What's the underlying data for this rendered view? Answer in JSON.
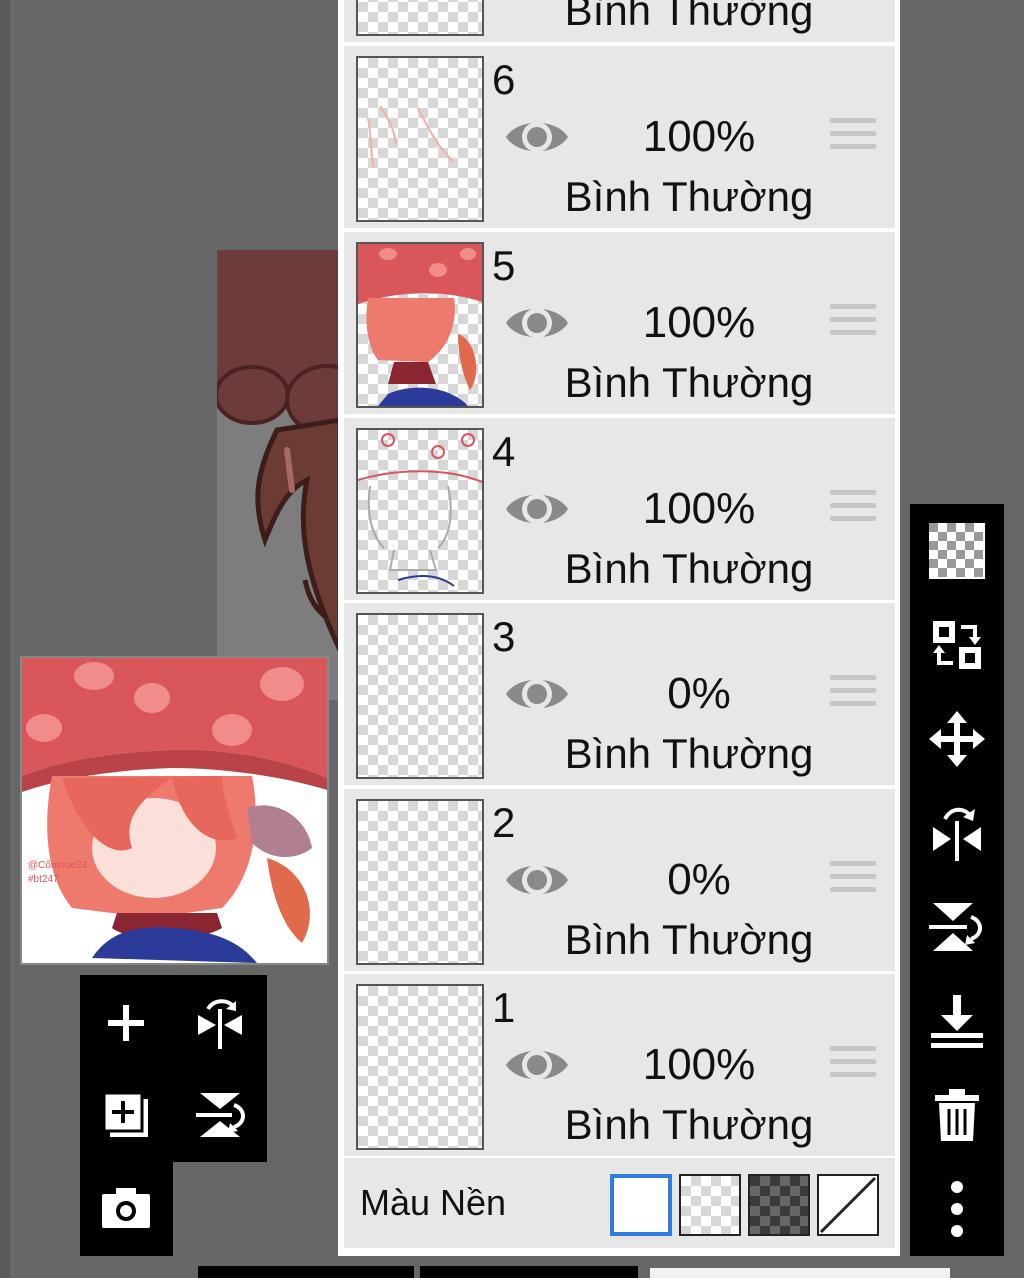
{
  "layers": [
    {
      "number": "",
      "opacity": "",
      "blend_mode": "Bình Thường"
    },
    {
      "number": "6",
      "opacity": "100%",
      "blend_mode": "Bình Thường"
    },
    {
      "number": "5",
      "opacity": "100%",
      "blend_mode": "Bình Thường"
    },
    {
      "number": "4",
      "opacity": "100%",
      "blend_mode": "Bình Thường"
    },
    {
      "number": "3",
      "opacity": "0%",
      "blend_mode": "Bình Thường"
    },
    {
      "number": "2",
      "opacity": "0%",
      "blend_mode": "Bình Thường"
    },
    {
      "number": "1",
      "opacity": "100%",
      "blend_mode": "Bình Thường"
    }
  ],
  "background": {
    "label": "Màu Nền",
    "options": [
      "white",
      "transparent",
      "dark-checker",
      "none"
    ],
    "selected": "white"
  },
  "right_toolbar": [
    "transparency-checker-icon",
    "swap-layer-icon",
    "move-icon",
    "flip-horizontal-icon",
    "flip-vertical-icon",
    "merge-down-icon",
    "trash-icon",
    "more-icon"
  ],
  "left_toolbar": [
    "add-layer-icon",
    "flip-horizontal-icon",
    "duplicate-layer-icon",
    "flip-vertical-icon",
    "camera-icon"
  ],
  "colors": {
    "selected": "#2f7de0",
    "panel_row": "#e7e7e7",
    "eye": "#8a8a8a",
    "handle": "#c6c6c6"
  },
  "preview": {
    "watermark": "@Cốmnoe23 #bt247"
  }
}
